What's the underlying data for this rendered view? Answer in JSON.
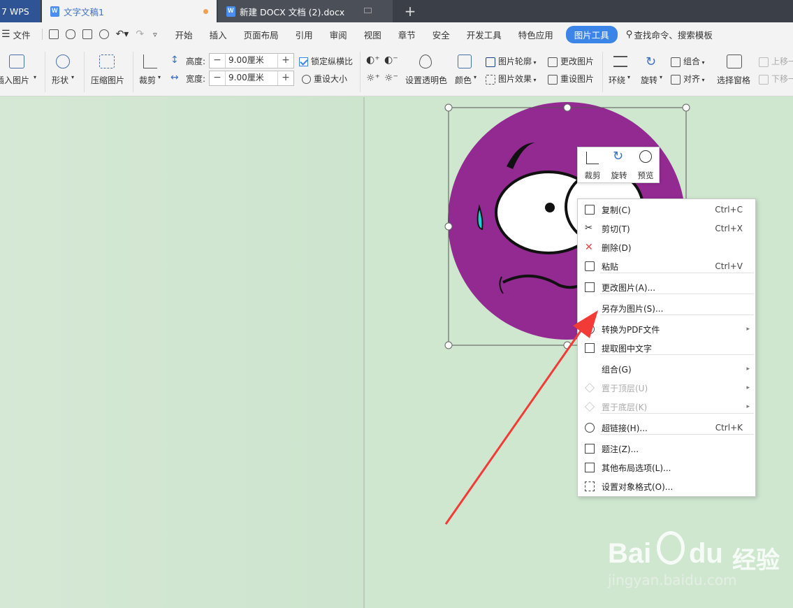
{
  "tabs": {
    "wps": "7 WPS",
    "doc1": "文字文稿1",
    "doc2": "新建 DOCX 文档 (2).docx",
    "add": "+"
  },
  "menubar": {
    "file": "文件",
    "items": [
      "开始",
      "插入",
      "页面布局",
      "引用",
      "审阅",
      "视图",
      "章节",
      "安全",
      "开发工具",
      "特色应用"
    ],
    "active": "图片工具",
    "search": "查找命令、搜索模板"
  },
  "ribbon": {
    "insert_picture": "插入图片",
    "shape": "形状",
    "compress": "压缩图片",
    "crop": "裁剪",
    "height_label": "高度:",
    "width_label": "宽度:",
    "height_value": "9.00厘米",
    "width_value": "9.00厘米",
    "lock_ratio": "锁定纵横比",
    "reset_size": "重设大小",
    "transparent": "设置透明色",
    "color": "颜色",
    "outline": "图片轮廓",
    "effect": "图片效果",
    "change_picture": "更改图片",
    "reset_picture": "重设图片",
    "wrap": "环绕",
    "rotate": "旋转",
    "group": "组合",
    "align": "对齐",
    "selection_pane": "选择窗格",
    "bring_forward": "上移一",
    "send_backward": "下移一"
  },
  "floatbar": {
    "crop": "裁剪",
    "rotate": "旋转",
    "preview": "预览"
  },
  "context_menu": [
    {
      "label": "复制(C)",
      "shortcut": "Ctrl+C",
      "icon": "copy-icon",
      "disabled": false
    },
    {
      "label": "剪切(T)",
      "shortcut": "Ctrl+X",
      "icon": "cut-icon",
      "disabled": false
    },
    {
      "label": "删除(D)",
      "shortcut": "",
      "icon": "delete-icon",
      "disabled": false
    },
    {
      "label": "粘贴",
      "shortcut": "Ctrl+V",
      "icon": "paste-icon",
      "disabled": false
    },
    {
      "label": "更改图片(A)...",
      "shortcut": "",
      "icon": "change-picture-icon",
      "disabled": false
    },
    {
      "label": "另存为图片(S)...",
      "shortcut": "",
      "icon": "",
      "disabled": false
    },
    {
      "label": "转换为PDF文件",
      "shortcut": "",
      "icon": "pdf-icon",
      "disabled": false
    },
    {
      "label": "提取图中文字",
      "shortcut": "",
      "icon": "extract-text-icon",
      "disabled": false
    },
    {
      "label": "组合(G)",
      "shortcut": "",
      "icon": "",
      "disabled": false
    },
    {
      "label": "置于顶层(U)",
      "shortcut": "",
      "icon": "bring-to-front-icon",
      "disabled": true
    },
    {
      "label": "置于底层(K)",
      "shortcut": "",
      "icon": "send-to-back-icon",
      "disabled": true
    },
    {
      "label": "超链接(H)...",
      "shortcut": "Ctrl+K",
      "icon": "link-icon",
      "disabled": false
    },
    {
      "label": "题注(Z)...",
      "shortcut": "",
      "icon": "caption-icon",
      "disabled": false
    },
    {
      "label": "其他布局选项(L)...",
      "shortcut": "",
      "icon": "layout-options-icon",
      "disabled": false
    },
    {
      "label": "设置对象格式(O)...",
      "shortcut": "",
      "icon": "format-object-icon",
      "disabled": false
    }
  ],
  "watermark": {
    "brand": "Bai",
    "brand2": "du",
    "cn": "经验",
    "url": "jingyan.baidu.com"
  },
  "colors": {
    "accent": "#3b84e8",
    "emoji_purple": "#932a92",
    "arrow_red": "#f23b36"
  }
}
